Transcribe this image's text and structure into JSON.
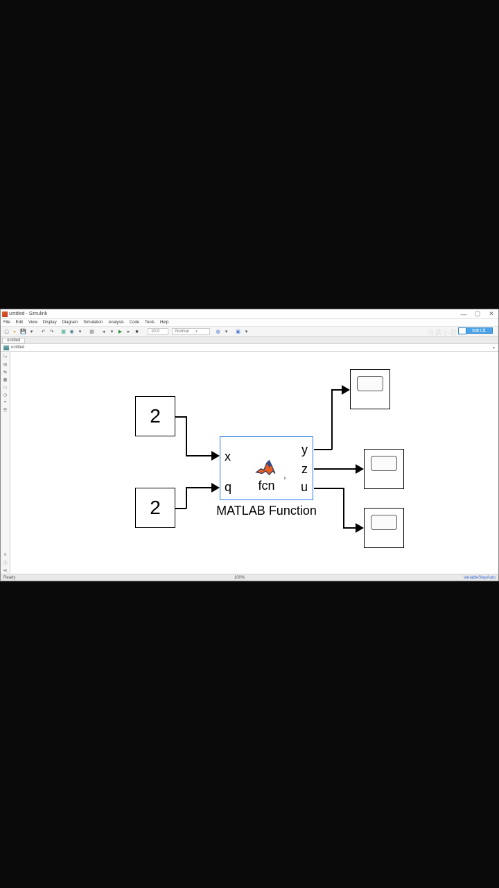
{
  "titlebar": {
    "title": "untitled - Simulink"
  },
  "menubar": {
    "items": [
      "File",
      "Edit",
      "View",
      "Display",
      "Diagram",
      "Simulation",
      "Analysis",
      "Code",
      "Tools",
      "Help"
    ]
  },
  "toolbar": {
    "mode_dropdown": "Normal",
    "time_field": "10.0",
    "blue_button": "加速工具",
    "faint_watermark": "马洪小软件"
  },
  "tabbar": {
    "tab": "untitled"
  },
  "breadcrumb": {
    "path": "untitled"
  },
  "canvas": {
    "const1": {
      "value": "2"
    },
    "const2": {
      "value": "2"
    },
    "fcn": {
      "ports_in": {
        "x": "x",
        "q": "q"
      },
      "ports_out": {
        "y": "y",
        "z": "z",
        "u": "u"
      },
      "name": "fcn",
      "caption": "MATLAB Function"
    }
  },
  "statusbar": {
    "left": "Ready",
    "zoom": "100%",
    "right": "VariableStepAuto"
  },
  "left_tools": [
    "⤿",
    "⊞",
    "⇆",
    "▦",
    "▭",
    "◷",
    "⌖",
    "☰",
    "",
    "",
    "",
    "",
    "",
    "",
    "",
    "",
    "",
    "",
    "",
    "",
    "",
    "",
    "",
    "",
    "",
    "",
    "≡",
    "ⓘ",
    "≪"
  ]
}
